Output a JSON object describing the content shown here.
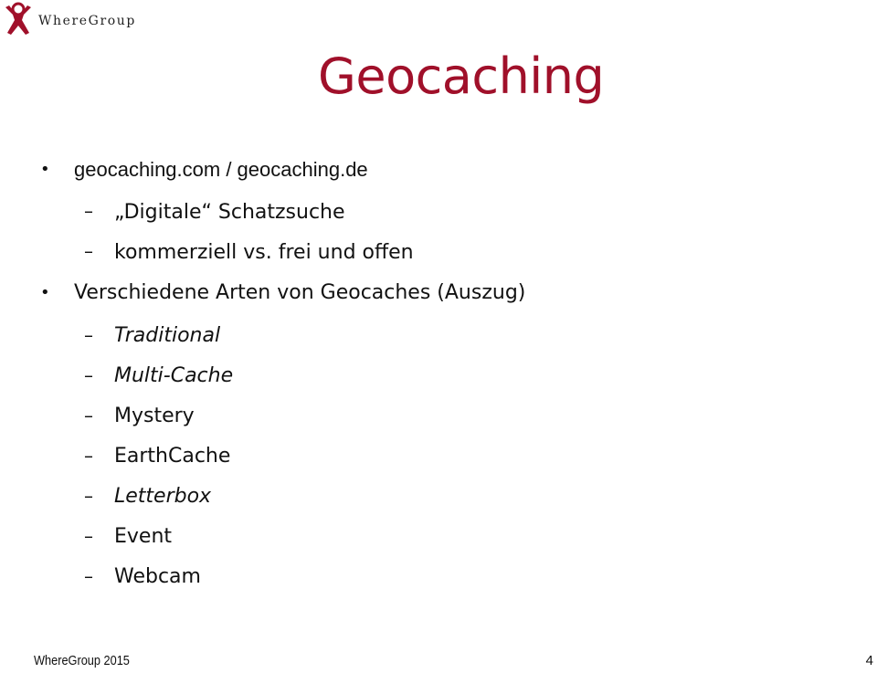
{
  "logo": {
    "text": "WhereGroup",
    "color": "#a0102a"
  },
  "slide": {
    "title": "Geocaching",
    "title_color": "#a0102a",
    "bullets": [
      {
        "text": "geocaching.com / geocaching.de",
        "subitems": [
          {
            "text": "„Digitale“ Schatzsuche",
            "italic": false
          },
          {
            "text": "kommerziell vs. frei und offen",
            "italic": false
          }
        ]
      },
      {
        "text": "Verschiedene Arten von Geocaches (Auszug)",
        "subitems": [
          {
            "text": "Traditional",
            "italic": true
          },
          {
            "text": "Multi-Cache",
            "italic": true
          },
          {
            "text": "Mystery",
            "italic": false
          },
          {
            "text": "EarthCache",
            "italic": false
          },
          {
            "text": "Letterbox",
            "italic": true
          },
          {
            "text": "Event",
            "italic": false
          },
          {
            "text": "Webcam",
            "italic": false
          }
        ]
      }
    ],
    "bullet_glyph": "•",
    "dash_glyph": "–"
  },
  "footer": {
    "left": "WhereGroup 2015",
    "page_number": "4"
  }
}
